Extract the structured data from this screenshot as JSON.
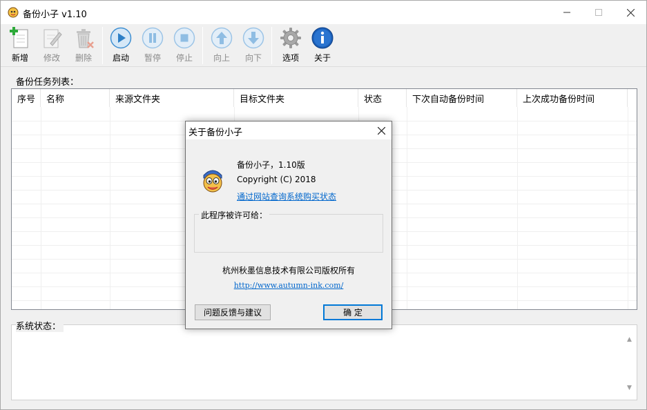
{
  "window": {
    "title": "备份小子 v1.10"
  },
  "toolbar": {
    "buttons": [
      {
        "label": "新增",
        "icon": "add-file-icon",
        "enabled": true
      },
      {
        "label": "修改",
        "icon": "edit-file-icon",
        "enabled": false
      },
      {
        "label": "删除",
        "icon": "trash-icon",
        "enabled": false
      },
      {
        "label": "启动",
        "icon": "play-icon",
        "enabled": true
      },
      {
        "label": "暂停",
        "icon": "pause-icon",
        "enabled": false
      },
      {
        "label": "停止",
        "icon": "stop-icon",
        "enabled": false
      },
      {
        "label": "向上",
        "icon": "arrow-up-icon",
        "enabled": false
      },
      {
        "label": "向下",
        "icon": "arrow-down-icon",
        "enabled": false
      },
      {
        "label": "选项",
        "icon": "gear-icon",
        "enabled": true
      },
      {
        "label": "关于",
        "icon": "info-icon",
        "enabled": true
      }
    ]
  },
  "task_list": {
    "label": "备份任务列表：",
    "columns": [
      "序号",
      "名称",
      "来源文件夹",
      "目标文件夹",
      "状态",
      "下次自动备份时间",
      "上次成功备份时间"
    ],
    "rows": []
  },
  "status": {
    "label": "系统状态："
  },
  "about_dialog": {
    "title": "关于备份小子",
    "app_name": "备份小子，1.10版",
    "copyright": "Copyright (C) 2018",
    "purchase_link": "通过网站查询系统购买状态",
    "license_label": "此程序被许可给：",
    "company": "杭州秋墨信息技术有限公司版权所有",
    "website": "http://www.autumn-ink.com/",
    "feedback_button": "问题反馈与建议",
    "ok_button": "确 定"
  },
  "colors": {
    "accent": "#0078d7",
    "link": "#0066cc",
    "toolbar_blue": "#5aa0dc"
  }
}
